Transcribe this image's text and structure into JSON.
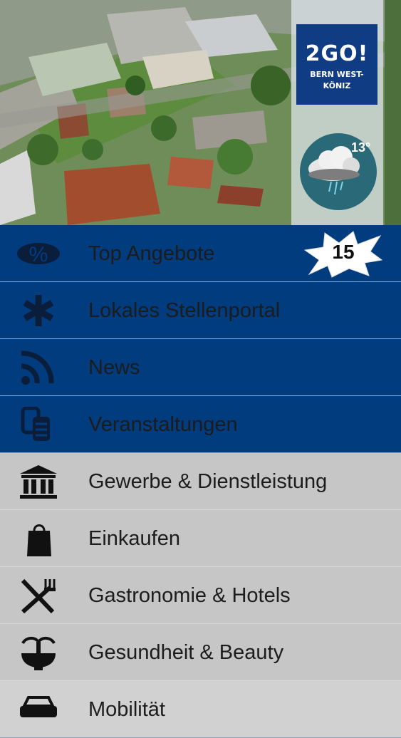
{
  "header": {
    "logo_line1": "2GO!",
    "logo_line2": "BERN WEST-",
    "logo_line3": "KÖNIZ",
    "weather_temperature": "13°"
  },
  "menu": {
    "items": [
      {
        "label": "Top Angebote",
        "icon": "percent-icon",
        "badge": "15"
      },
      {
        "label": "Lokales Stellenportal",
        "icon": "asterisk-icon"
      },
      {
        "label": "News",
        "icon": "rss-icon"
      },
      {
        "label": "Veranstaltungen",
        "icon": "tickets-icon"
      },
      {
        "label": "Gewerbe & Dienstleistung",
        "icon": "bank-icon"
      },
      {
        "label": "Einkaufen",
        "icon": "shopping-bag-icon"
      },
      {
        "label": "Gastronomie & Hotels",
        "icon": "fork-knife-icon"
      },
      {
        "label": "Gesundheit & Beauty",
        "icon": "fountain-icon"
      },
      {
        "label": "Mobilität",
        "icon": "car-icon"
      }
    ]
  },
  "colors": {
    "menu_blue": "#003c7e",
    "menu_gray": "#c6c6c6",
    "logo_blue": "#0f3c82"
  }
}
